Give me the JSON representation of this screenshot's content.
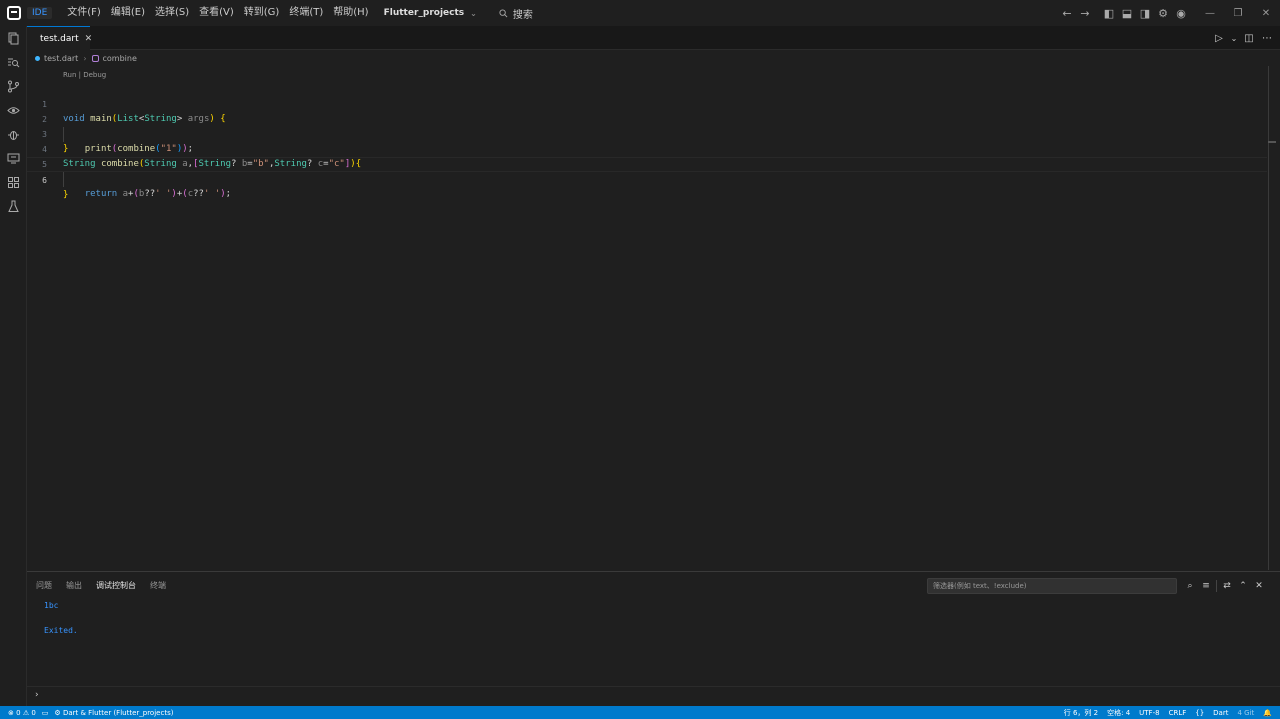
{
  "titlebar": {
    "ide_badge": "IDE",
    "menu": [
      "文件(F)",
      "编辑(E)",
      "选择(S)",
      "查看(V)",
      "转到(G)",
      "终端(T)",
      "帮助(H)"
    ],
    "workspace": "Flutter_projects",
    "search_label": "搜索"
  },
  "tab": {
    "filename": "test.dart",
    "close": "✕"
  },
  "breadcrumb": {
    "file": "test.dart",
    "symbol": "combine"
  },
  "codelens": "Run | Debug",
  "editor": {
    "line_numbers": [
      "1",
      "2",
      "3",
      "4",
      "5",
      "6"
    ],
    "current_line": 6,
    "lines": [
      "void main(List<String> args) {",
      "    print(combine(\"1\"));",
      "}",
      "String combine(String a,[String? b=\"b\",String? c=\"c\"]){",
      "    return a+(b??' ')+(c??' ');",
      "}"
    ]
  },
  "panel": {
    "tabs": [
      "问题",
      "输出",
      "调试控制台",
      "终端"
    ],
    "active_tab": "调试控制台",
    "filter_placeholder": "筛选器(例如 text、!exclude)",
    "output": [
      "1bc",
      "Exited."
    ],
    "prompt": "›"
  },
  "statusbar": {
    "errors": "0",
    "warnings": "0",
    "run_config": "Dart & Flutter (Flutter_projects)",
    "position": "行 6，列 2",
    "spaces": "空格: 4",
    "encoding": "UTF-8",
    "eol": "CRLF",
    "braces": "{}",
    "language": "Dart",
    "extra": "4 Git"
  },
  "colors": {
    "accent": "#007acc",
    "keyword": "#569cd6",
    "type": "#4ec9b0",
    "string": "#ce9178",
    "console_output": "#3794ff"
  }
}
